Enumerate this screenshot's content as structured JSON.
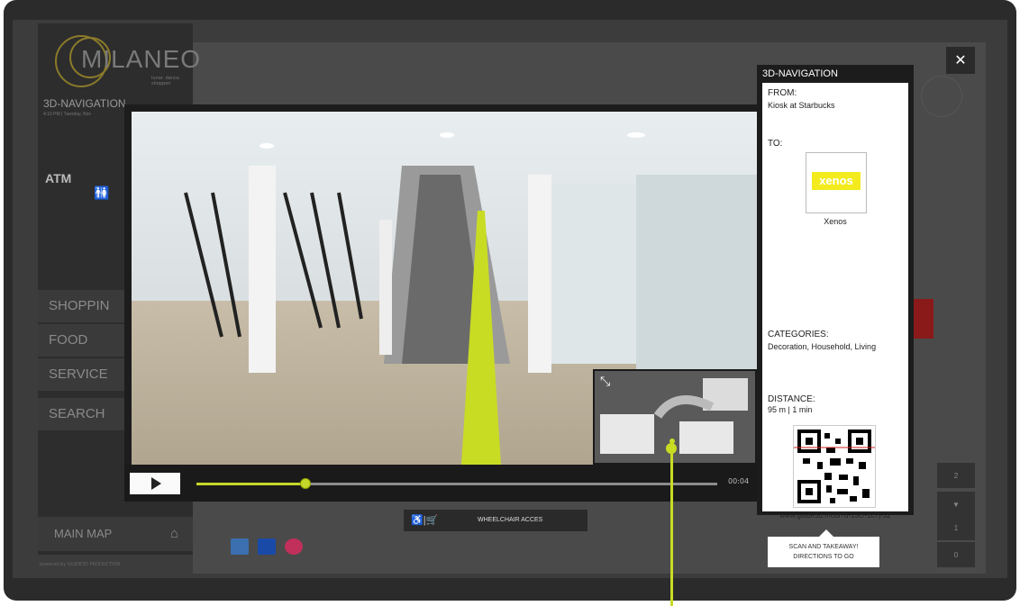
{
  "brand": {
    "logo_text": "MILANEO",
    "logo_sub": "lunar. dance. shoppen"
  },
  "sidebar": {
    "title": "3D-NAVIGATION",
    "subtitle": "4:10 PM | Tuesday, Nov",
    "atm_label": "ATM",
    "menu": [
      "SHOPPIN",
      "FOOD",
      "SERVICE",
      "SEARCH"
    ],
    "main_map_label": "MAIN MAP",
    "main_map_sub": "powered by GUIDE3D PRODUCTION"
  },
  "video": {
    "time": "00:04",
    "progress": 0.21
  },
  "wheelchair": {
    "label": "WHEELCHAIR ACCES"
  },
  "panel": {
    "header": "3D-NAVIGATION",
    "from_label": "FROM:",
    "from_value": "Kiosk at Starbucks",
    "to_label": "TO:",
    "destination_logo": "xenos",
    "destination_name": "Xenos",
    "categories_label": "CATEGORIES:",
    "categories_value": "Decoration, Household, Living",
    "distance_label": "DISTANCE:",
    "distance_value": "95 m | 1 min",
    "qr_url": "www.guide3d.mobi?u-13cr-1c7j-32",
    "scan_line1": "SCAN AND TAKEAWAY!",
    "scan_line2": "DIRECTIONS TO GO"
  },
  "close_label": "✕",
  "floors": [
    "2",
    "▼",
    "1",
    "0"
  ],
  "colors": {
    "accent": "#c9dc24",
    "xenos_yellow": "#f3eb1d",
    "panel_bg": "#1c1c1c"
  }
}
